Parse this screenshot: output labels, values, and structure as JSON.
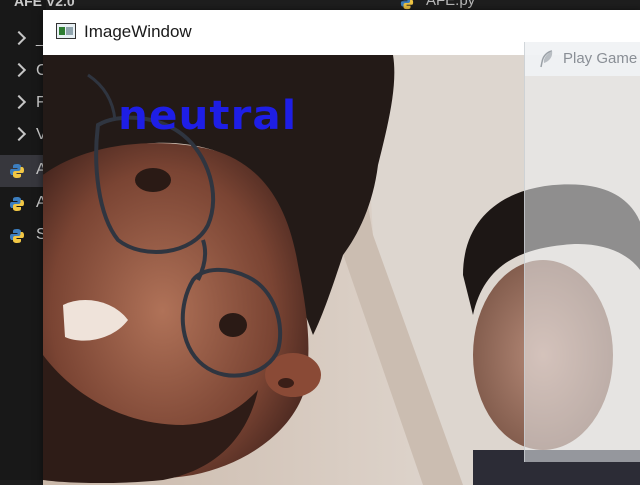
{
  "editor": {
    "project_title": "AFE V2.0",
    "open_tab": "AFE.py",
    "tree_rows": [
      {
        "kind": "folder",
        "letter": "_"
      },
      {
        "kind": "folder",
        "letter": "C"
      },
      {
        "kind": "folder",
        "letter": "F"
      },
      {
        "kind": "folder",
        "letter": "V"
      },
      {
        "kind": "python-file",
        "letter": "A"
      },
      {
        "kind": "python-file",
        "letter": "A"
      },
      {
        "kind": "python-file",
        "letter": "S"
      }
    ]
  },
  "image_window": {
    "title": "ImageWindow",
    "emotion_label": "neutral",
    "label_color": "#1e1ee6"
  },
  "game_window": {
    "title": "Play Game"
  },
  "icons": {
    "app_icon": "image-window-icon",
    "game_icon": "feather-icon",
    "file_icon": "python-icon"
  }
}
